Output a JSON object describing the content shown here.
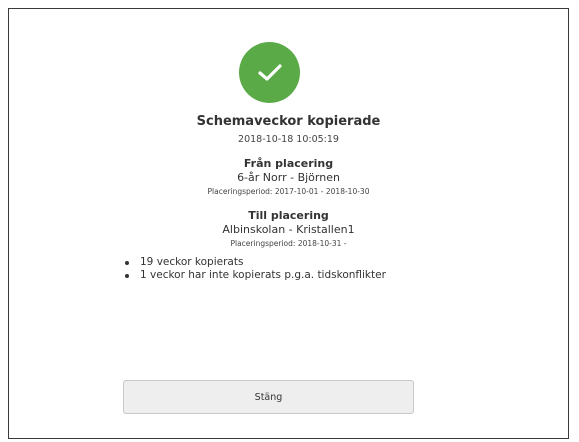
{
  "dialog": {
    "title": "Schemaveckor kopierade",
    "timestamp": "2018-10-18 10:05:19",
    "from": {
      "heading": "Från placering",
      "value": "6-år Norr - Björnen",
      "period": "Placeringsperiod: 2017-10-01 - 2018-10-30"
    },
    "to": {
      "heading": "Till placering",
      "value": "Albinskolan - Kristallen1",
      "period": "Placeringsperiod: 2018-10-31 -"
    },
    "results": [
      "19 veckor kopierats",
      "1 veckor har inte kopierats p.g.a. tidskonflikter"
    ],
    "close_label": "Stäng"
  },
  "colors": {
    "success": "#5aaa47",
    "button_bg": "#eeeeee",
    "border": "#3a3a3a"
  },
  "icons": {
    "status": "checkmark-icon"
  }
}
